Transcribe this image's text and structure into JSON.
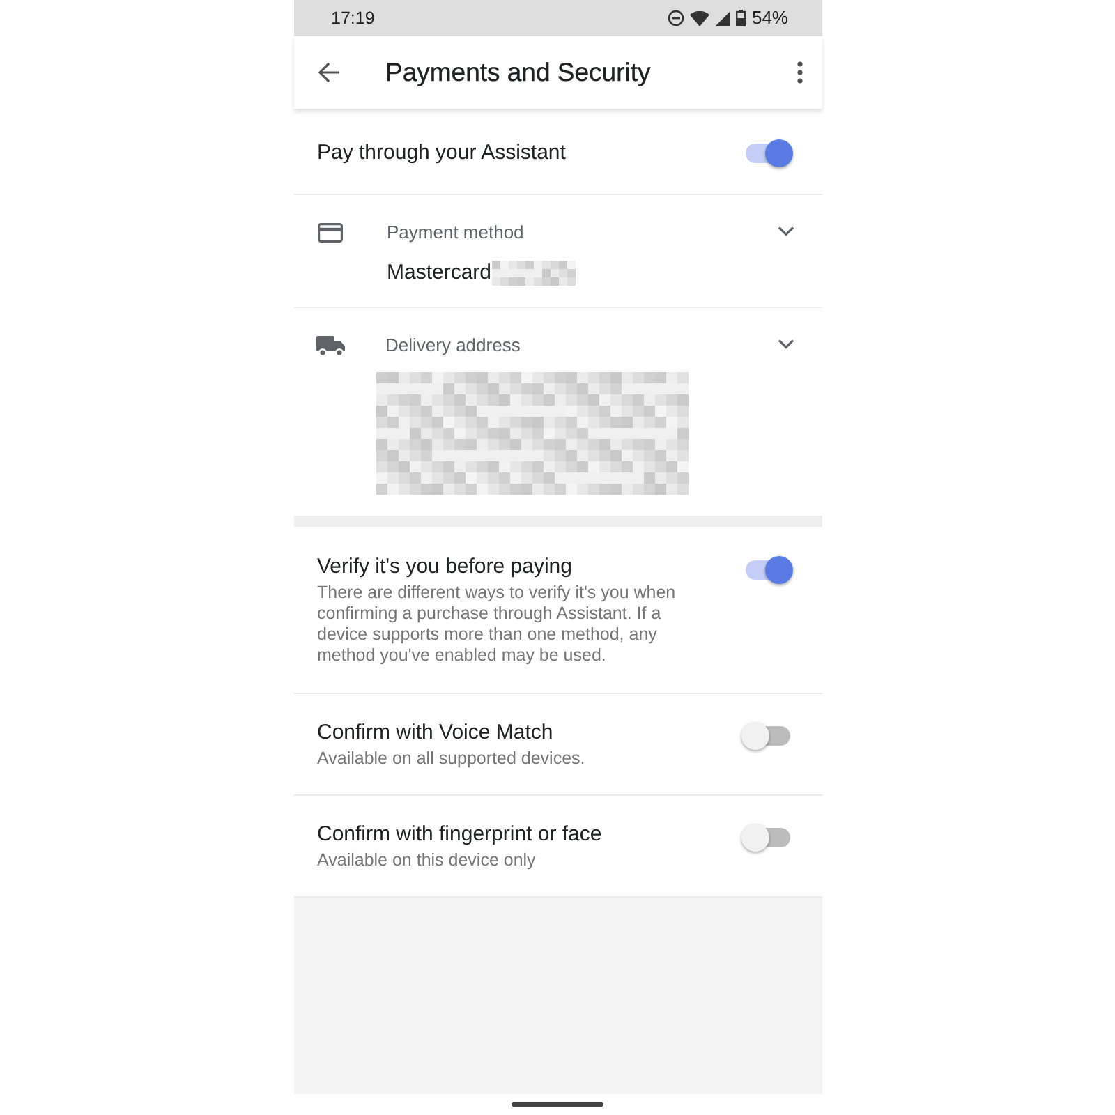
{
  "status_bar": {
    "time": "17:19",
    "battery": "54%"
  },
  "app_bar": {
    "title": "Payments and Security"
  },
  "payment_toggle": {
    "title": "Pay through your Assistant",
    "on": true
  },
  "payment_method": {
    "label": "Payment method",
    "value": "Mastercard"
  },
  "delivery_address": {
    "label": "Delivery address"
  },
  "verification": [
    {
      "title": "Verify it's you before paying",
      "description": "There are different ways to verify it's you when confirming a purchase through Assistant. If a device supports more than one method, any method you've enabled may be used.",
      "on": true
    },
    {
      "title": "Confirm with Voice Match",
      "description": "Available on all supported devices.",
      "on": false
    },
    {
      "title": "Confirm with fingerprint or face",
      "description": "Available on this device only",
      "on": false
    }
  ]
}
